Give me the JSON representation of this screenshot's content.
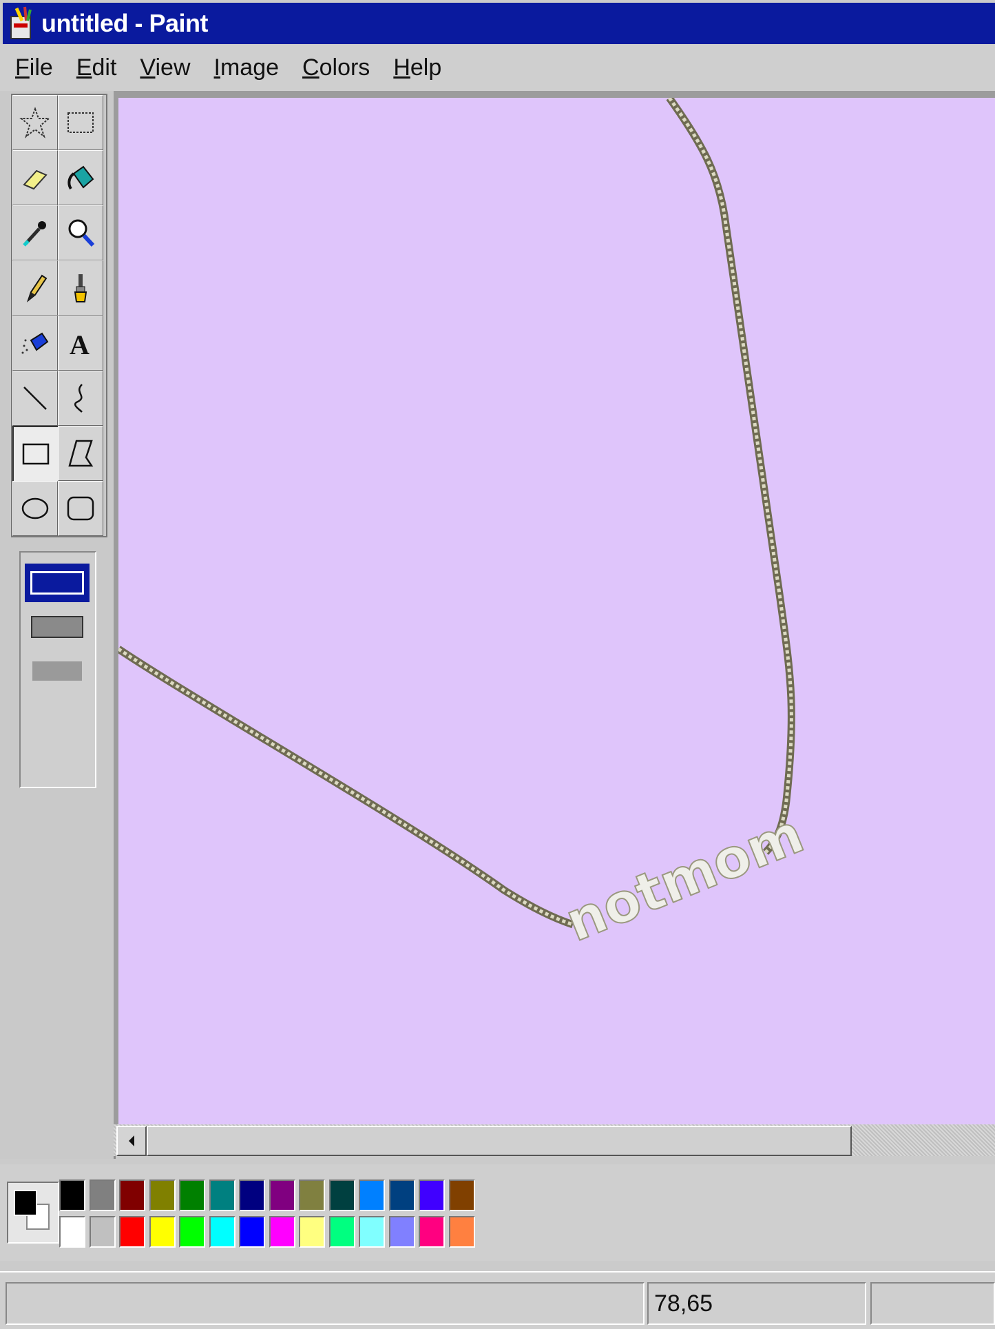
{
  "window": {
    "title": "untitled - Paint",
    "title_bar_color": "#0a1a9e"
  },
  "menu": [
    {
      "label": "File",
      "accel": "F",
      "rest": "ile"
    },
    {
      "label": "Edit",
      "accel": "E",
      "rest": "dit"
    },
    {
      "label": "View",
      "accel": "V",
      "rest": "iew"
    },
    {
      "label": "Image",
      "accel": "I",
      "rest": "mage"
    },
    {
      "label": "Colors",
      "accel": "C",
      "rest": "olors"
    },
    {
      "label": "Help",
      "accel": "H",
      "rest": "elp"
    }
  ],
  "tools": [
    "free-form-select-icon",
    "select-icon",
    "eraser-icon",
    "fill-bucket-icon",
    "color-picker-icon",
    "magnifier-icon",
    "pencil-icon",
    "brush-icon",
    "airbrush-icon",
    "text-icon",
    "line-icon",
    "curve-icon",
    "rectangle-icon",
    "polygon-icon",
    "ellipse-icon",
    "rounded-rectangle-icon"
  ],
  "active_tool": "rectangle-icon",
  "canvas": {
    "background": "#dfc5fb",
    "pendant_text": "notmom"
  },
  "palette": {
    "foreground": "#000000",
    "background": "#ffffff",
    "top_row": [
      "#000000",
      "#808080",
      "#800000",
      "#808000",
      "#008000",
      "#008080",
      "#000080",
      "#800080",
      "#808040",
      "#004040",
      "#0080ff",
      "#004080",
      "#4000ff",
      "#804000"
    ],
    "bottom_row": [
      "#ffffff",
      "#c0c0c0",
      "#ff0000",
      "#ffff00",
      "#00ff00",
      "#00ffff",
      "#0000ff",
      "#ff00ff",
      "#ffff80",
      "#00ff80",
      "#80ffff",
      "#8080ff",
      "#ff0080",
      "#ff8040"
    ]
  },
  "status": {
    "coords": "78,65"
  }
}
